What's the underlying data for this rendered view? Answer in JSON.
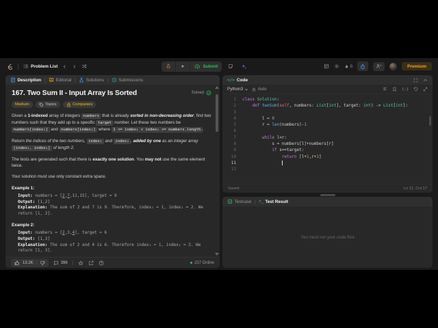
{
  "header": {
    "problem_list": "Problem List",
    "submit": "Submit",
    "streak": "0",
    "premium": "Premium"
  },
  "description": {
    "tabs": [
      {
        "label": "Description"
      },
      {
        "label": "Editorial"
      },
      {
        "label": "Solutions"
      },
      {
        "label": "Submissions"
      }
    ],
    "title": "167. Two Sum II - Input Array Is Sorted",
    "solved": "Solved",
    "badges": {
      "difficulty": "Medium",
      "topics": "Topics",
      "companies": "Companies"
    },
    "paragraphs": [
      [
        {
          "t": "Given a ",
          "s": "p"
        },
        {
          "t": "1-indexed",
          "s": "b"
        },
        {
          "t": " array of integers ",
          "s": "p"
        },
        {
          "t": "numbers",
          "s": "c"
        },
        {
          "t": " that is already ",
          "s": "p"
        },
        {
          "t": "sorted in non-decreasing order",
          "s": "bi"
        },
        {
          "t": ", find two numbers such that they add up to a specific ",
          "s": "p"
        },
        {
          "t": "target",
          "s": "c"
        },
        {
          "t": " number. Let these two numbers be ",
          "s": "p"
        },
        {
          "t": "numbers[index₁]",
          "s": "c"
        },
        {
          "t": " and ",
          "s": "p"
        },
        {
          "t": "numbers[index₂]",
          "s": "c"
        },
        {
          "t": " where ",
          "s": "p"
        },
        {
          "t": "1 <= index₁ < index₂ <= numbers.length",
          "s": "c"
        },
        {
          "t": ".",
          "s": "p"
        }
      ],
      [
        {
          "t": "Return ",
          "s": "p"
        },
        {
          "t": "the indices of the two numbers, ",
          "s": "i"
        },
        {
          "t": "index₁",
          "s": "c"
        },
        {
          "t": " and ",
          "s": "i"
        },
        {
          "t": "index₂",
          "s": "c"
        },
        {
          "t": ", ",
          "s": "i"
        },
        {
          "t": "added by one",
          "s": "bi"
        },
        {
          "t": " as an integer array ",
          "s": "i"
        },
        {
          "t": "[index₁, index₂]",
          "s": "c"
        },
        {
          "t": " of length 2.",
          "s": "i"
        }
      ],
      [
        {
          "t": "The tests are generated such that there is ",
          "s": "p"
        },
        {
          "t": "exactly one solution",
          "s": "b"
        },
        {
          "t": ". You ",
          "s": "p"
        },
        {
          "t": "may not",
          "s": "b"
        },
        {
          "t": " use the same element twice.",
          "s": "p"
        }
      ],
      [
        {
          "t": "Your solution must use only constant extra space.",
          "s": "p"
        }
      ]
    ],
    "examples": [
      {
        "heading": "Example 1:",
        "rows": [
          [
            {
              "t": "Input: ",
              "s": "ml"
            },
            {
              "t": "numbers = [",
              "s": "m"
            },
            {
              "t": "2",
              "s": "mu"
            },
            {
              "t": ",",
              "s": "m"
            },
            {
              "t": "7",
              "s": "mu"
            },
            {
              "t": ",11,15], target = 9",
              "s": "m"
            }
          ],
          [
            {
              "t": "Output: ",
              "s": "ml"
            },
            {
              "t": "[1,2]",
              "s": "m"
            }
          ],
          [
            {
              "t": "Explanation: ",
              "s": "ml"
            },
            {
              "t": "The sum of 2 and 7 is 9. Therefore, index₁ = 1, index₂ = 2. We return [1, 2].",
              "s": "m"
            }
          ]
        ]
      },
      {
        "heading": "Example 2:",
        "rows": [
          [
            {
              "t": "Input: ",
              "s": "ml"
            },
            {
              "t": "numbers = [",
              "s": "m"
            },
            {
              "t": "2",
              "s": "mu"
            },
            {
              "t": ",3,",
              "s": "m"
            },
            {
              "t": "4",
              "s": "mu"
            },
            {
              "t": "], target = 6",
              "s": "m"
            }
          ],
          [
            {
              "t": "Output: ",
              "s": "ml"
            },
            {
              "t": "[1,3]",
              "s": "m"
            }
          ],
          [
            {
              "t": "Explanation: ",
              "s": "ml"
            },
            {
              "t": "The sum of 2 and 4 is 6. Therefore index₁ = 1, index₂ = 3. We return [1, 3].",
              "s": "m"
            }
          ]
        ]
      }
    ],
    "footer": {
      "likes": "13.2K",
      "comments": "396",
      "online": "237 Online"
    }
  },
  "code": {
    "panel_title": "Code",
    "code_glyph": "</>",
    "language": "Python3",
    "auto": "Auto",
    "braces_glyph": "{;}",
    "active_line": 11,
    "lines": [
      [
        {
          "t": "class ",
          "c": "kw"
        },
        {
          "t": "Solution",
          "c": "ty"
        },
        {
          "t": ":",
          "c": "pl"
        }
      ],
      [
        {
          "t": "    ",
          "c": "pl"
        },
        {
          "t": "def ",
          "c": "kw"
        },
        {
          "t": "twoSum",
          "c": "fn"
        },
        {
          "t": "(",
          "c": "pl"
        },
        {
          "t": "self",
          "c": "kw2"
        },
        {
          "t": ", numbers: ",
          "c": "pl"
        },
        {
          "t": "List",
          "c": "ty"
        },
        {
          "t": "[",
          "c": "pl"
        },
        {
          "t": "int",
          "c": "ty"
        },
        {
          "t": "], target: ",
          "c": "pl"
        },
        {
          "t": "int",
          "c": "ty"
        },
        {
          "t": ") -> ",
          "c": "pl"
        },
        {
          "t": "List",
          "c": "ty"
        },
        {
          "t": "[",
          "c": "pl"
        },
        {
          "t": "int",
          "c": "ty"
        },
        {
          "t": "]:",
          "c": "pl"
        }
      ],
      [],
      [
        {
          "t": "        l = ",
          "c": "pl"
        },
        {
          "t": "0",
          "c": "nu"
        }
      ],
      [
        {
          "t": "        r = ",
          "c": "pl"
        },
        {
          "t": "len",
          "c": "fn"
        },
        {
          "t": "(numbers)-",
          "c": "pl"
        },
        {
          "t": "1",
          "c": "nu"
        }
      ],
      [],
      [
        {
          "t": "        ",
          "c": "pl"
        },
        {
          "t": "while",
          "c": "kw"
        },
        {
          "t": " l<r:",
          "c": "pl"
        }
      ],
      [
        {
          "t": "            s = numbers[l]+numbers[r]",
          "c": "pl"
        }
      ],
      [
        {
          "t": "            ",
          "c": "pl"
        },
        {
          "t": "if",
          "c": "kw"
        },
        {
          "t": " s==target:",
          "c": "pl"
        }
      ],
      [
        {
          "t": "                ",
          "c": "pl"
        },
        {
          "t": "return",
          "c": "kw"
        },
        {
          "t": " [l+",
          "c": "pl"
        },
        {
          "t": "1",
          "c": "nu"
        },
        {
          "t": ",r+",
          "c": "pl"
        },
        {
          "t": "1",
          "c": "nu"
        },
        {
          "t": "]",
          "c": "pl"
        }
      ],
      [],
      []
    ],
    "saved": "Saved",
    "position": "Ln 11, Col 17"
  },
  "console": {
    "testcase_tab": "Testcase",
    "result_tab": "Test Result",
    "terminal_glyph": ">_",
    "message": "You must run your code first"
  }
}
